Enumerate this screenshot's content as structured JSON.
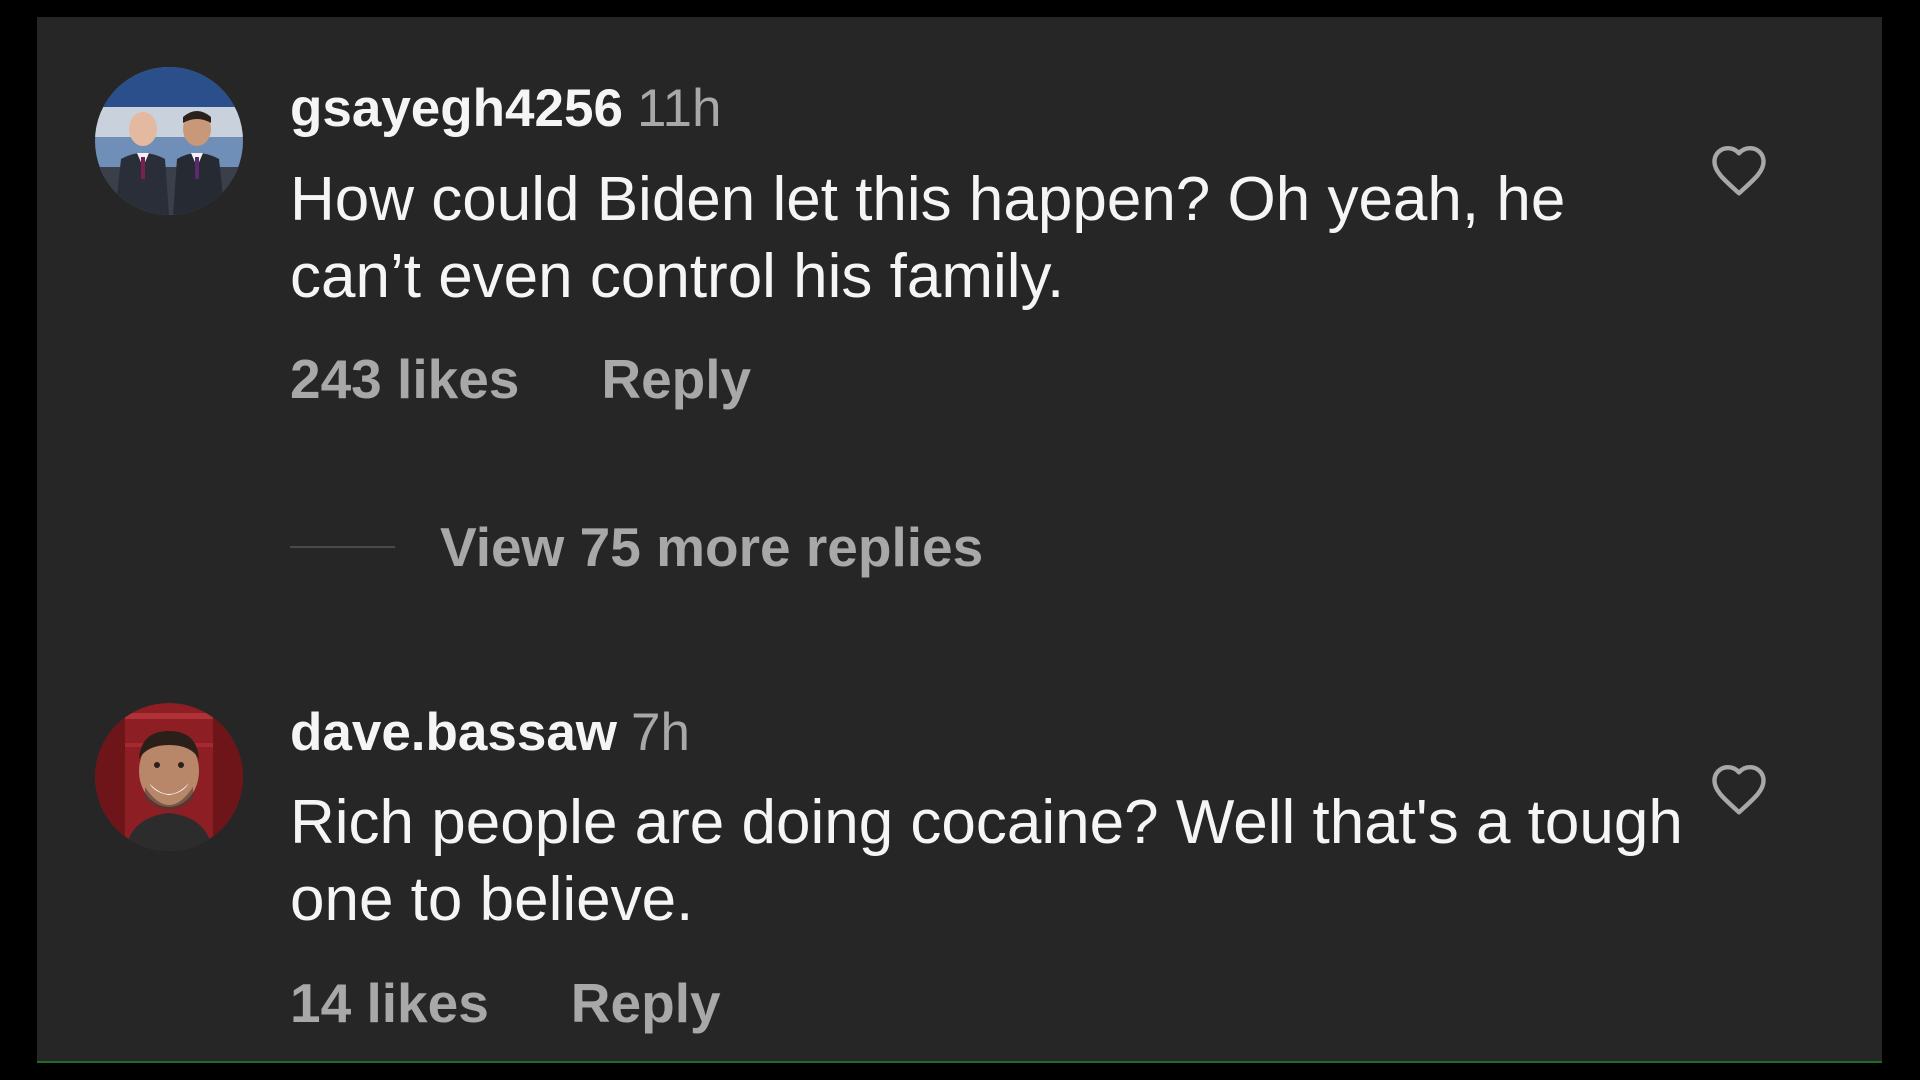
{
  "comments": [
    {
      "username": "gsayegh4256",
      "time": "11h",
      "text": "How could Biden let this happen? Oh yeah, he can’t even control his family.",
      "likes": "243 likes",
      "reply_label": "Reply",
      "avatar_icon": "avatar-two-men-in-suits",
      "like_icon": "heart-outline-icon"
    },
    {
      "username": "dave.bassaw",
      "time": "7h",
      "text": "Rich people are doing cocaine? Well that's a tough one to believe.",
      "likes": "14 likes",
      "reply_label": "Reply",
      "avatar_icon": "avatar-smiling-man",
      "like_icon": "heart-outline-icon"
    }
  ],
  "view_replies": {
    "label": "View 75 more replies"
  },
  "colors": {
    "background": "#262626",
    "text_primary": "#f5f5f5",
    "text_secondary": "#a8a8a8",
    "frame": "#000000"
  }
}
